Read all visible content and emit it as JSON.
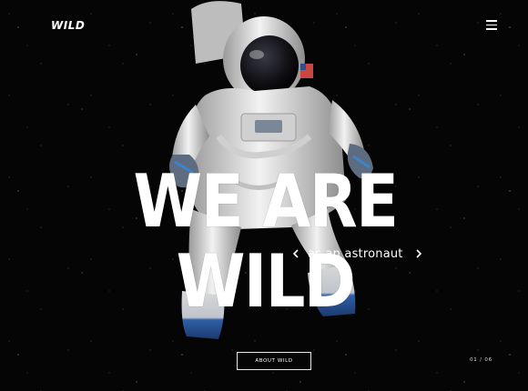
{
  "header": {
    "logo_text": "WILD",
    "menu_icon": "hamburger-menu-icon"
  },
  "hero": {
    "headline": "WE ARE WILD",
    "subtitle": "as an astronaut",
    "prev_icon": "chevron-left-icon",
    "next_icon": "chevron-right-icon",
    "image": "astronaut-photo"
  },
  "cta": {
    "about_label": "ABOUT WILD"
  },
  "pager": {
    "current": "01",
    "separator": "/",
    "total": "06"
  },
  "colors": {
    "background": "#050505",
    "text": "#ffffff",
    "suit": "#e6e6e6",
    "boots": "#2f5fa8"
  }
}
